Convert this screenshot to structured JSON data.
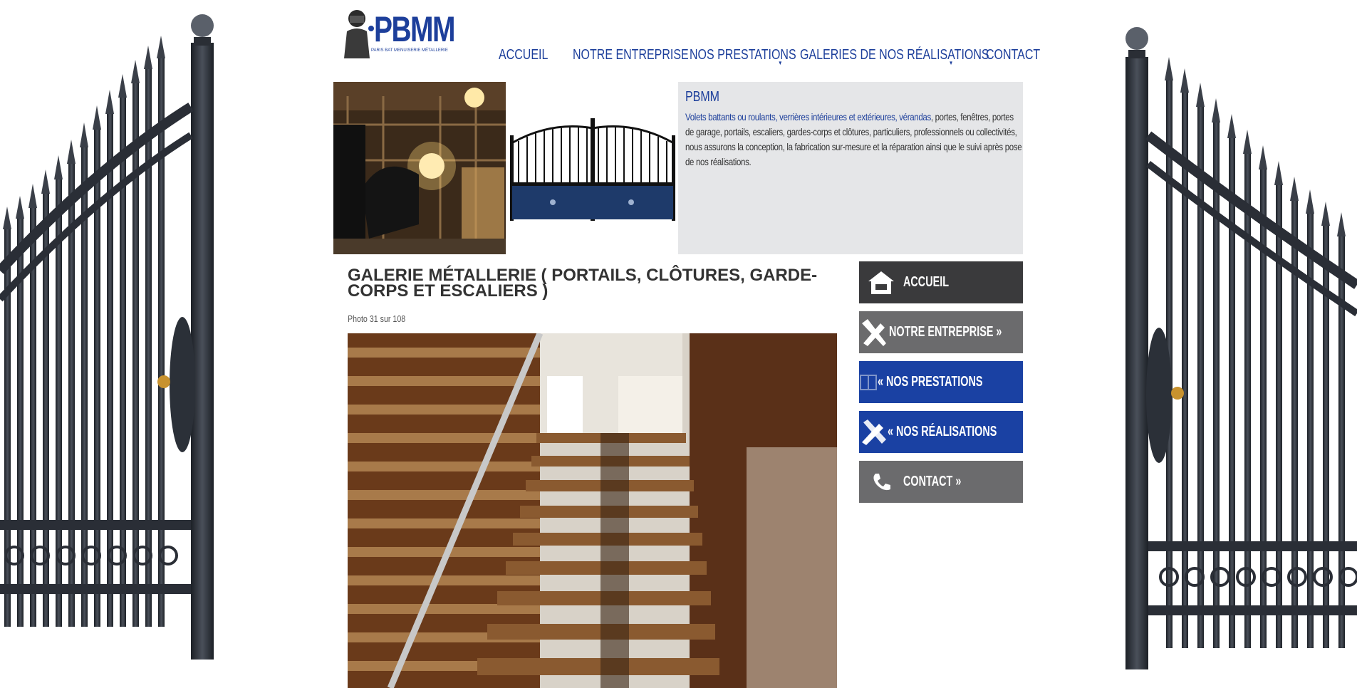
{
  "brand": {
    "name": "PBMM",
    "tagline": "PARIS BAT MENUISERIE MÉTALLERIE"
  },
  "topnav": [
    {
      "label": "ACCUEIL",
      "has_dropdown": false
    },
    {
      "label": "NOTRE ENTREPRISE",
      "has_dropdown": false
    },
    {
      "label": "NOS PRESTATIONS",
      "has_dropdown": true
    },
    {
      "label": "GALERIES DE NOS RÉALISATIONS",
      "has_dropdown": true
    },
    {
      "label": "CONTACT",
      "has_dropdown": false
    }
  ],
  "intro": {
    "title": "PBMM",
    "highlight": "Volets battants ou roulants, verrières intérieures et extérieures, vérandas",
    "text": ", portes, fenêtres, portes de garage, portails, escaliers, gardes-corps et clôtures, particuliers, professionnels ou collectivités, nous assurons la conception, la fabrication sur-mesure et la réparation ainsi que le suivi après pose de nos réalisations."
  },
  "gallery": {
    "title": "GALERIE MÉTALLERIE ( PORTAILS, CLÔTURES, GARDE-CORPS ET ESCALIERS )",
    "counter": "Photo 31 sur 108"
  },
  "sidemenu": [
    {
      "label": "ACCUEIL",
      "icon": "home-icon",
      "style": "dark"
    },
    {
      "label": "NOTRE ENTREPRISE »",
      "icon": "tools-icon",
      "style": "grey"
    },
    {
      "label": "« NOS PRESTATIONS",
      "icon": "book-icon",
      "style": "blue"
    },
    {
      "label": "« NOS RÉALISATIONS",
      "icon": "pencil-ruler-icon",
      "style": "blue"
    },
    {
      "label": "CONTACT »",
      "icon": "phone-icon",
      "style": "grey"
    }
  ],
  "colors": {
    "brand_blue": "#1d3f9b",
    "menu_blue": "#1a41a3",
    "menu_dark": "#3a3a3c",
    "menu_grey": "#6b6b6d",
    "intro_bg": "#e5e6e8"
  }
}
